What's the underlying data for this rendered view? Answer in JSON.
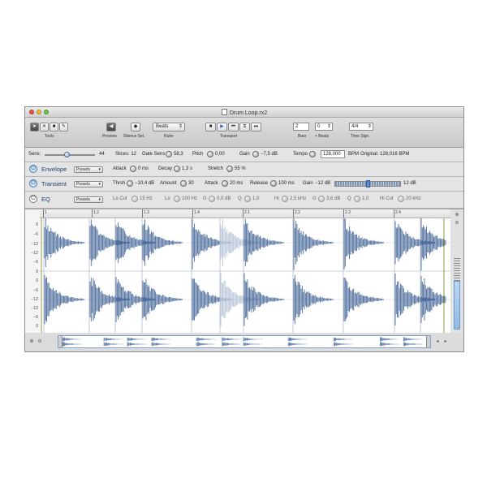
{
  "window": {
    "title": "Drum Loop.rx2"
  },
  "toolbar": {
    "tools_caption": "Tools",
    "preview_caption": "Preview",
    "silence_caption": "Silence Sel.",
    "ruler_caption": "Ruler",
    "ruler_value": "Beats",
    "transport_caption": "Transport",
    "bars_caption": "Bars",
    "beats_caption": "+ Beats",
    "timesig_caption": "Time Sign.",
    "bars_value": "2",
    "beats_value": "0",
    "timesig_value": "4/4"
  },
  "info_row": {
    "sens_label": "Sens:",
    "sens_value": "44",
    "sens_level": 0.44,
    "slices_label": "Slices: 12",
    "gatesens_label": "Gate Sens",
    "gatesens_value": "58,3",
    "pitch_label": "Pitch",
    "pitch_value": "0,00",
    "gain_label": "Gain",
    "gain_value": "−7,5 dB",
    "tempo_label": "Tempo",
    "tempo_value": "128,000",
    "bpm_label": "BPM",
    "original_label": "Original: 128,016 BPM"
  },
  "envelope": {
    "name": "Envelope",
    "presets": "Presets",
    "attack_label": "Attack",
    "attack_value": "0 ms",
    "decay_label": "Decay",
    "decay_value": "1,3 s",
    "stretch_label": "Stretch",
    "stretch_value": "55 %"
  },
  "transient": {
    "name": "Transient",
    "presets": "Presets",
    "thrsh_label": "Thrsh",
    "thrsh_value": "−10,4 dB",
    "amount_label": "Amount",
    "amount_value": "30",
    "attack_label": "Attack",
    "attack_value": "20 ms",
    "release_label": "Release",
    "release_value": "100 ms",
    "gain_label": "Gain",
    "gain_min": "−12 dB",
    "gain_max": "12 dB",
    "gain_level": 0.5
  },
  "eq": {
    "name": "EQ",
    "presets": "Presets",
    "locut_label": "Lo Cut",
    "locut_value": "15 Hz",
    "lo_label": "Lo",
    "lo_value": "100 Hz",
    "lo_g_label": "G",
    "lo_g_value": "0,0 dB",
    "lo_q_label": "Q",
    "lo_q_value": "1,0",
    "hi_label": "Hi",
    "hi_value": "2,5 kHz",
    "hi_g_label": "G",
    "hi_g_value": "3,6 dB",
    "hi_q_label": "Q",
    "hi_q_value": "1,0",
    "hicut_label": "Hi Cut",
    "hicut_value": "20 kHz"
  },
  "ruler_marks": [
    "1",
    "1.2",
    "1.3",
    "1.4",
    "2.1",
    "2.2",
    "2.3",
    "2.4"
  ],
  "scale_labels": [
    "0",
    "−6",
    "−12",
    "−12",
    "−6",
    "0",
    "0",
    "−6",
    "−12",
    "−12",
    "−6",
    "0"
  ],
  "colors": {
    "wave": "#4a6a9a",
    "wave_dim": "#b8c4d8",
    "accent": "#5b8fd0",
    "marker": "#8a9a4a"
  },
  "icons": [
    "arrow-tool-icon",
    "mute-tool-icon",
    "lock-tool-icon",
    "pencil-tool-icon",
    "speaker-icon",
    "silence-icon",
    "stop-icon",
    "play-icon",
    "rewind-icon",
    "loop-icon",
    "forward-icon",
    "power-icon",
    "zoom-icon"
  ]
}
